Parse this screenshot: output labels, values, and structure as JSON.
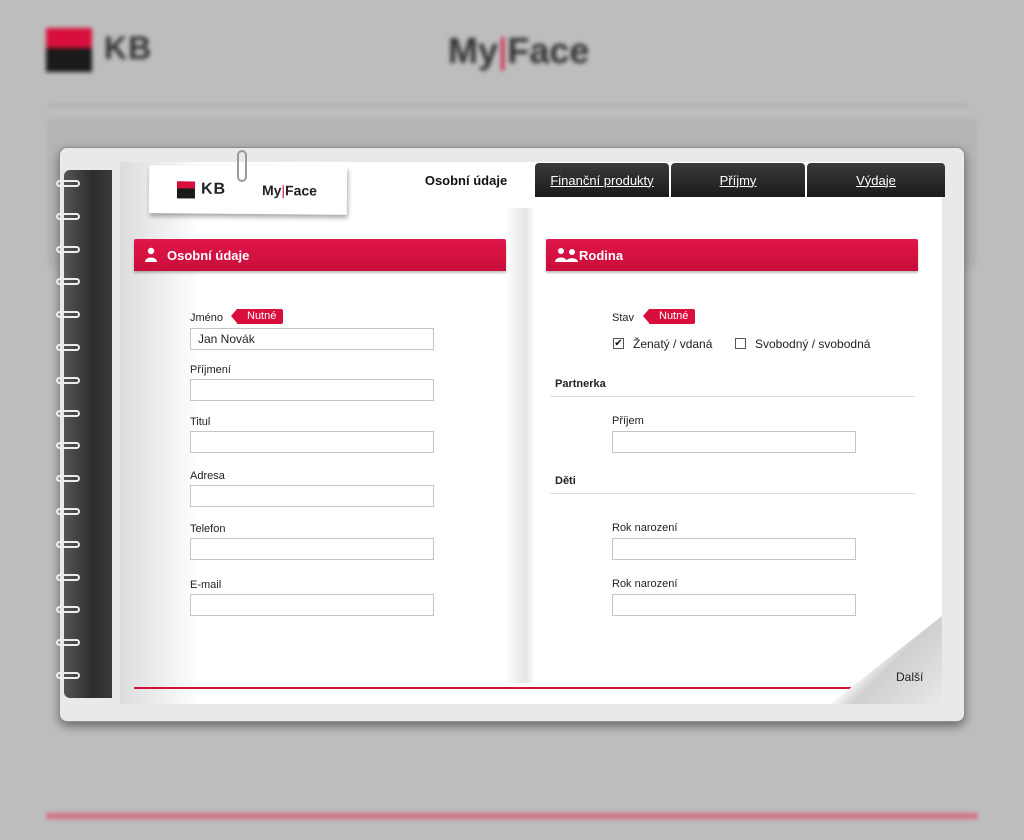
{
  "background": {
    "logo_text": "KB",
    "brand_left": "My",
    "brand_bar": "|",
    "brand_right": "Face"
  },
  "sticker": {
    "logo_text": "KB",
    "brand_left": "My",
    "brand_bar": "|",
    "brand_right": "Face"
  },
  "tabs": [
    {
      "label": "Osobní údaje",
      "active": true
    },
    {
      "label": "Finanční produkty",
      "active": false
    },
    {
      "label": "Příjmy",
      "active": false
    },
    {
      "label": "Výdaje",
      "active": false
    }
  ],
  "personal": {
    "header": "Osobní údaje",
    "required_badge": "Nutné",
    "fields": [
      {
        "label": "Jméno",
        "value": "Jan Novák"
      },
      {
        "label": "Příjmení",
        "value": ""
      },
      {
        "label": "Titul",
        "value": ""
      },
      {
        "label": "Adresa",
        "value": ""
      },
      {
        "label": "Telefon",
        "value": ""
      },
      {
        "label": "E-mail",
        "value": ""
      }
    ]
  },
  "family": {
    "header": "Rodina",
    "status_label": "Stav",
    "required_badge": "Nutné",
    "options": [
      {
        "label": "Ženatý / vdaná",
        "checked": true,
        "check_mark": "✔"
      },
      {
        "label": "Svobodný / svobodná",
        "checked": false,
        "check_mark": ""
      }
    ],
    "partner_heading": "Partnerka",
    "partner_income_label": "Příjem",
    "partner_income_value": "",
    "children_heading": "Děti",
    "children": [
      {
        "label": "Rok narození",
        "value": ""
      },
      {
        "label": "Rok narození",
        "value": ""
      }
    ]
  },
  "next_label": "Další",
  "colors": {
    "accent": "#d80f3c",
    "dark": "#1b1b1b"
  }
}
